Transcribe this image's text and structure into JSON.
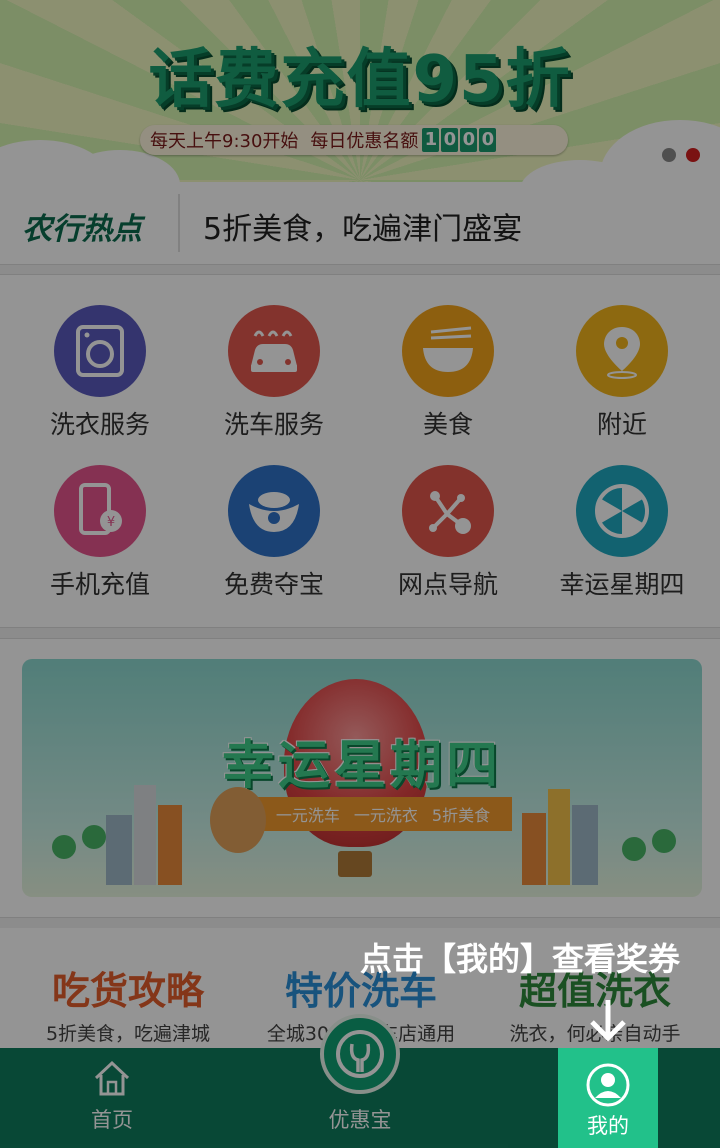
{
  "banner": {
    "title": "话费充值95折",
    "subtitle_start": "每天上午9:30开始",
    "subtitle_quota": "每日优惠名额",
    "quota_digits": [
      "1",
      "0",
      "0",
      "0"
    ],
    "page_dots": 2,
    "active_dot": 2
  },
  "hot_news": {
    "label": "农行热点",
    "text": "5折美食，吃遍津门盛宴"
  },
  "services": [
    {
      "label": "洗衣服务",
      "icon": "washing-machine-icon",
      "color": "#5a5bbd"
    },
    {
      "label": "洗车服务",
      "icon": "car-wash-icon",
      "color": "#e2584f"
    },
    {
      "label": "美食",
      "icon": "bowl-icon",
      "color": "#f3a41b"
    },
    {
      "label": "附近",
      "icon": "location-pin-icon",
      "color": "#f3b61c"
    },
    {
      "label": "手机充值",
      "icon": "phone-recharge-icon",
      "color": "#e5558d"
    },
    {
      "label": "免费夺宝",
      "icon": "treasure-icon",
      "color": "#2f73c9"
    },
    {
      "label": "网点导航",
      "icon": "network-nav-icon",
      "color": "#e2574c"
    },
    {
      "label": "幸运星期四",
      "icon": "lucky-wheel-icon",
      "color": "#1fa9c2"
    }
  ],
  "promo": {
    "title": "幸运星期四",
    "ribbon": [
      "一元洗车",
      "一元洗衣",
      "5折美食"
    ]
  },
  "trio": [
    {
      "title": "吃货攻略",
      "sub": "5折美食，吃遍津城",
      "color": "#e35e2c"
    },
    {
      "title": "特价洗车",
      "sub": "全城300家洗车店通用",
      "color": "#2a8fd8"
    },
    {
      "title": "超值洗衣",
      "sub": "洗衣，何必亲自动手",
      "color": "#2e8a3c"
    }
  ],
  "nav": {
    "home": "首页",
    "center": "优惠宝",
    "me": "我的"
  },
  "hint": {
    "text": "点击【我的】查看奖券"
  },
  "colors": {
    "brand_green": "#0f7d5e",
    "highlight_green": "#22c18a"
  }
}
